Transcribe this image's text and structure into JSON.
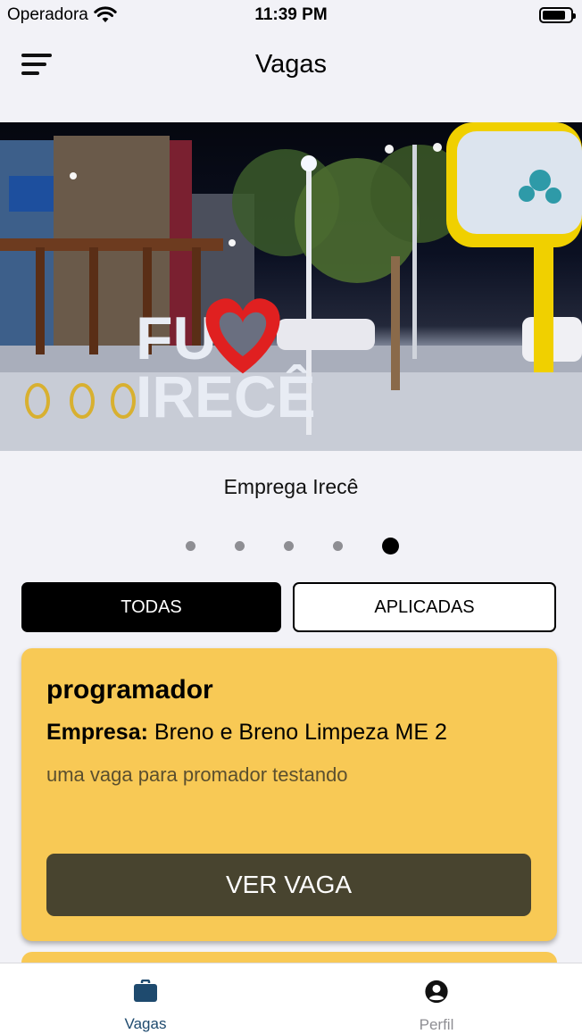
{
  "status_bar": {
    "carrier": "Operadora",
    "time": "11:39 PM"
  },
  "header": {
    "title": "Vagas",
    "menu_icon": "menu-icon"
  },
  "carousel": {
    "caption": "Emprega Irecê",
    "sign_text_line1": "FU",
    "sign_text_line2": "IRECÊ",
    "slide_count": 5,
    "active_index": 4
  },
  "filters": {
    "all_label": "TODAS",
    "applied_label": "APLICADAS",
    "selected": "TODAS"
  },
  "jobs": [
    {
      "title": "programador",
      "company_label": "Empresa:",
      "company": "Breno e Breno Limpeza ME 2",
      "description": "uma vaga para promador testando",
      "button_label": "VER VAGA"
    }
  ],
  "tabbar": {
    "items": [
      {
        "label": "Vagas",
        "icon": "briefcase-icon",
        "active": true
      },
      {
        "label": "Perfil",
        "icon": "user-circle-icon",
        "active": false
      }
    ]
  },
  "colors": {
    "card": "#f8c955",
    "card_button": "#48442f",
    "active_tab": "#1e4a6e"
  }
}
